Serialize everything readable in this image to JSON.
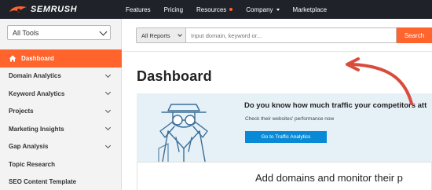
{
  "topbar": {
    "logo_text": "SEMRUSH",
    "nav": [
      {
        "label": "Features",
        "badge": false,
        "caret": false
      },
      {
        "label": "Pricing",
        "badge": false,
        "caret": false
      },
      {
        "label": "Resources",
        "badge": true,
        "caret": false
      },
      {
        "label": "Company",
        "badge": false,
        "caret": true
      },
      {
        "label": "Marketplace",
        "badge": false,
        "caret": false
      }
    ]
  },
  "sidebar": {
    "tools_select": "All Tools",
    "items": [
      {
        "label": "Dashboard",
        "active": true,
        "expandable": false
      },
      {
        "label": "Domain Analytics",
        "active": false,
        "expandable": true
      },
      {
        "label": "Keyword Analytics",
        "active": false,
        "expandable": true
      },
      {
        "label": "Projects",
        "active": false,
        "expandable": true
      },
      {
        "label": "Marketing Insights",
        "active": false,
        "expandable": true
      },
      {
        "label": "Gap Analysis",
        "active": false,
        "expandable": true
      },
      {
        "label": "Topic Research",
        "active": false,
        "expandable": false
      },
      {
        "label": "SEO Content Template",
        "active": false,
        "expandable": false
      }
    ]
  },
  "search": {
    "reports_select": "All Reports",
    "placeholder": "Input domain, keyword or...",
    "button_label": "Search"
  },
  "main": {
    "title": "Dashboard",
    "promo": {
      "headline": "Do you know how much traffic your competitors att",
      "subtext": "Check their websites' performance now",
      "button_label": "Go to Traffic Analytics"
    },
    "panel2_title": "Add domains and monitor their p"
  },
  "colors": {
    "topbar_bg": "#1f2329",
    "accent_orange": "#ff642d",
    "button_blue": "#0a8ad6",
    "promo_bg": "#e6f0f7",
    "arrow_red": "#d94b3c"
  }
}
